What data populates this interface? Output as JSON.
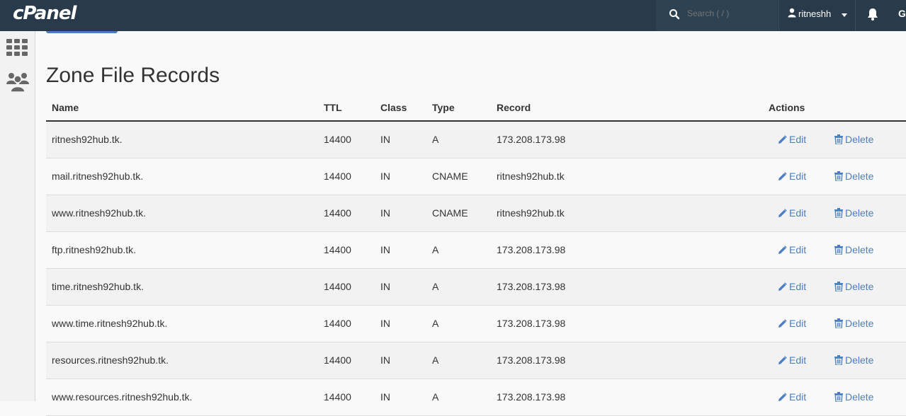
{
  "header": {
    "logo": "cPanel",
    "search_placeholder": "Search ( / )",
    "username": "ritneshh",
    "more_label": "G"
  },
  "page": {
    "title": "Zone File Records"
  },
  "table": {
    "columns": {
      "name": "Name",
      "ttl": "TTL",
      "class": "Class",
      "type": "Type",
      "record": "Record",
      "actions": "Actions"
    },
    "edit_label": "Edit",
    "delete_label": "Delete",
    "rows": [
      {
        "name": "ritnesh92hub.tk.",
        "ttl": "14400",
        "class": "IN",
        "type": "A",
        "record": "173.208.173.98"
      },
      {
        "name": "mail.ritnesh92hub.tk.",
        "ttl": "14400",
        "class": "IN",
        "type": "CNAME",
        "record": "ritnesh92hub.tk"
      },
      {
        "name": "www.ritnesh92hub.tk.",
        "ttl": "14400",
        "class": "IN",
        "type": "CNAME",
        "record": "ritnesh92hub.tk"
      },
      {
        "name": "ftp.ritnesh92hub.tk.",
        "ttl": "14400",
        "class": "IN",
        "type": "A",
        "record": "173.208.173.98"
      },
      {
        "name": "time.ritnesh92hub.tk.",
        "ttl": "14400",
        "class": "IN",
        "type": "A",
        "record": "173.208.173.98"
      },
      {
        "name": "www.time.ritnesh92hub.tk.",
        "ttl": "14400",
        "class": "IN",
        "type": "A",
        "record": "173.208.173.98"
      },
      {
        "name": "resources.ritnesh92hub.tk.",
        "ttl": "14400",
        "class": "IN",
        "type": "A",
        "record": "173.208.173.98"
      },
      {
        "name": "www.resources.ritnesh92hub.tk.",
        "ttl": "14400",
        "class": "IN",
        "type": "A",
        "record": "173.208.173.98"
      }
    ]
  },
  "icons": {
    "search": "search-icon",
    "user": "user-icon",
    "bell": "bell-icon",
    "apps": "grid-icon",
    "users": "users-icon",
    "edit": "pencil-icon",
    "delete": "trash-icon"
  },
  "colors": {
    "topbar": "#293a4a",
    "link": "#4a7ec0",
    "text": "#333333"
  }
}
